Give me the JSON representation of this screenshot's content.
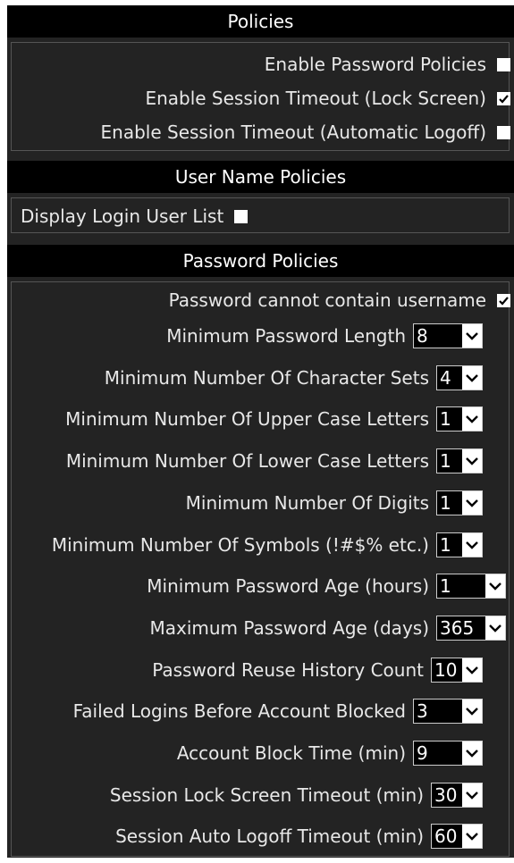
{
  "policies": {
    "title": "Policies",
    "items": [
      {
        "label": "Enable Password Policies",
        "checked": false
      },
      {
        "label": "Enable Session Timeout (Lock Screen)",
        "checked": true
      },
      {
        "label": "Enable Session Timeout (Automatic Logoff)",
        "checked": false
      }
    ]
  },
  "user_name_policies": {
    "title": "User Name Policies",
    "items": [
      {
        "label": "Display Login User List",
        "checked": false
      }
    ]
  },
  "password_policies": {
    "title": "Password Policies",
    "checkbox_item": {
      "label": "Password cannot contain username",
      "checked": true
    },
    "select_items": [
      {
        "label": "Minimum Password Length",
        "value": "8"
      },
      {
        "label": "Minimum Number Of Character Sets",
        "value": "4"
      },
      {
        "label": "Minimum Number Of Upper Case Letters",
        "value": "1"
      },
      {
        "label": "Minimum Number Of Lower Case Letters",
        "value": "1"
      },
      {
        "label": "Minimum Number Of Digits",
        "value": "1"
      },
      {
        "label": "Minimum Number Of Symbols (!#$% etc.)",
        "value": "1"
      },
      {
        "label": "Minimum Password Age (hours)",
        "value": "1"
      },
      {
        "label": "Maximum Password Age (days)",
        "value": "365"
      },
      {
        "label": "Password Reuse History Count",
        "value": "10"
      },
      {
        "label": "Failed Logins Before Account Blocked",
        "value": "3"
      },
      {
        "label": "Account Block Time (min)",
        "value": "9"
      },
      {
        "label": "Session Lock Screen Timeout (min)",
        "value": "30"
      },
      {
        "label": "Session Auto Logoff Timeout (min)",
        "value": "60"
      }
    ]
  },
  "colors": {
    "panel_background": "#232323",
    "header_background": "#000000",
    "text": "#e8e8e8"
  }
}
